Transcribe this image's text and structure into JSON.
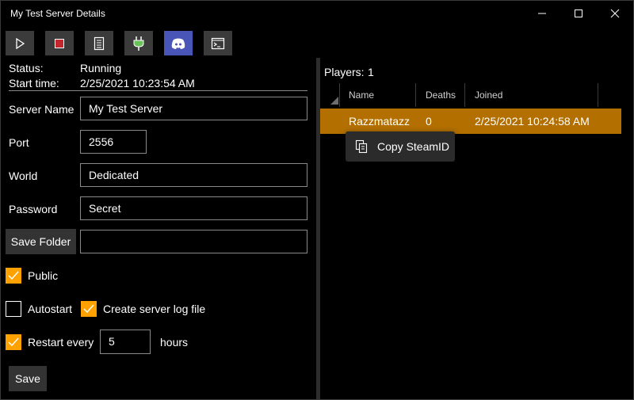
{
  "window": {
    "title": "My Test Server Details",
    "minimize_glyph": "—",
    "maximize_glyph": "☐",
    "close_glyph": "✕"
  },
  "toolbar": {
    "buttons": [
      {
        "name": "start-icon",
        "tooltip": ""
      },
      {
        "name": "stop-icon",
        "tooltip": ""
      },
      {
        "name": "notebook-icon",
        "tooltip": ""
      },
      {
        "name": "plug-icon",
        "tooltip": ""
      },
      {
        "name": "discord-icon",
        "tooltip": ""
      },
      {
        "name": "terminal-icon",
        "tooltip": ""
      }
    ],
    "stop_color": "#c1272d",
    "plug_color": "#6ac25a",
    "discord_color": "#5865f2"
  },
  "status": {
    "status_label": "Status:",
    "status_value": "Running",
    "start_label": "Start time:",
    "start_value": "2/25/2021 10:23:54 AM"
  },
  "form": {
    "server_name_label": "Server Name",
    "server_name_value": "My Test Server",
    "port_label": "Port",
    "port_value": "2556",
    "world_label": "World",
    "world_value": "Dedicated",
    "password_label": "Password",
    "password_value": "Secret",
    "save_folder_button": "Save Folder",
    "save_folder_value": "",
    "public_label": "Public",
    "public_checked": true,
    "autostart_label": "Autostart",
    "autostart_checked": false,
    "log_label": "Create server log file",
    "log_checked": true,
    "restart_label": "Restart every",
    "restart_checked": true,
    "restart_value": "5",
    "restart_unit": "hours",
    "save_button": "Save"
  },
  "players": {
    "label": "Players:",
    "count": "1",
    "columns": [
      "Name",
      "Deaths",
      "Joined"
    ],
    "rows": [
      {
        "name": "Razzmatazz",
        "deaths": "0",
        "joined": "2/25/2021 10:24:58 AM"
      }
    ],
    "selected_color": "#b37000"
  },
  "context_menu": {
    "items": [
      {
        "label": "Copy SteamID",
        "icon": "copy-icon"
      }
    ]
  },
  "colors": {
    "accent": "#ffa200",
    "background": "#000000",
    "button": "#3b3b3b"
  }
}
